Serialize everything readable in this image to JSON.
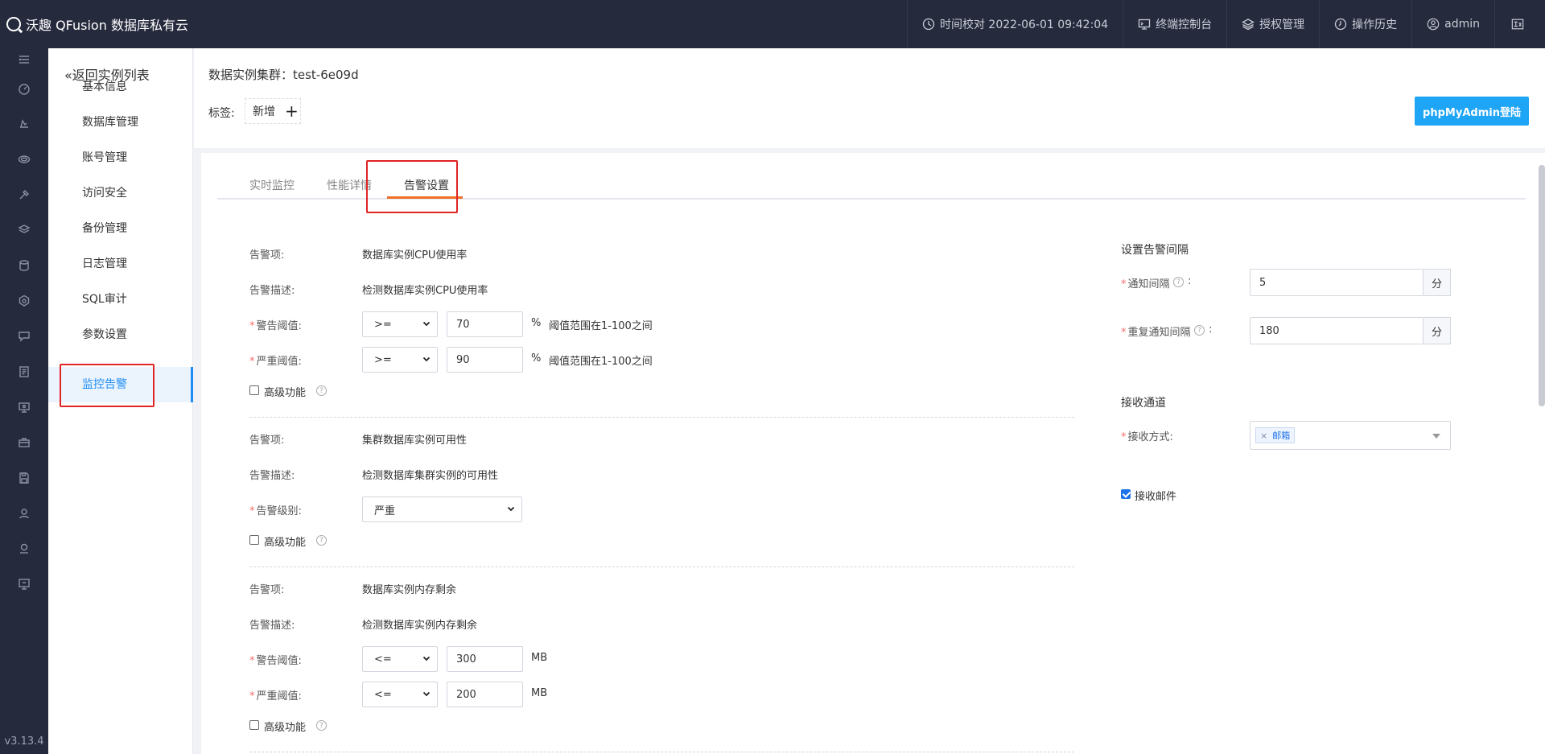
{
  "app": {
    "title": "沃趣 QFusion 数据库私有云",
    "version": "v3.13.4"
  },
  "topbar": {
    "time_sync": "时间校对 2022-06-01 09:42:04",
    "terminal": "终端控制台",
    "license": "授权管理",
    "history": "操作历史",
    "user": "admin"
  },
  "rail": {
    "icons": [
      "menu-icon",
      "dashboard-icon",
      "cloud-icon",
      "database-icon",
      "tools-icon",
      "layers-icon",
      "storage-icon",
      "security-icon",
      "feedback-icon",
      "document-icon",
      "monitor-icon",
      "briefcase-icon",
      "save-icon",
      "users-icon",
      "account-icon",
      "screen-icon"
    ]
  },
  "subnav": {
    "back": "返回实例列表",
    "items": [
      "基本信息",
      "数据库管理",
      "账号管理",
      "访问安全",
      "备份管理",
      "日志管理",
      "SQL审计",
      "参数设置",
      "监控告警"
    ],
    "active_index": 8
  },
  "header": {
    "cluster_label": "数据实例集群：test-6e09d",
    "tags_label": "标签:",
    "tag_new": "新增",
    "phpmyadmin_button": "phpMyAdmin登陆"
  },
  "tabs": [
    "实时监控",
    "性能详情",
    "告警设置"
  ],
  "active_tab": 2,
  "alerts": [
    {
      "item_label": "告警项:",
      "item_value": "数据库实例CPU使用率",
      "desc_label": "告警描述:",
      "desc_value": "检测数据库实例CPU使用率",
      "warn_label": "警告阈值:",
      "warn_op": ">=",
      "warn_value": "70",
      "warn_unit": "%",
      "warn_hint": "阈值范围在1-100之间",
      "crit_label": "严重阈值:",
      "crit_op": ">=",
      "crit_value": "90",
      "crit_unit": "%",
      "crit_hint": "阈值范围在1-100之间",
      "advanced": "高级功能"
    },
    {
      "item_label": "告警项:",
      "item_value": "集群数据库实例可用性",
      "desc_label": "告警描述:",
      "desc_value": "检测数据库集群实例的可用性",
      "level_label": "告警级别:",
      "level_value": "严重",
      "advanced": "高级功能"
    },
    {
      "item_label": "告警项:",
      "item_value": "数据库实例内存剩余",
      "desc_label": "告警描述:",
      "desc_value": "检测数据库实例内存剩余",
      "warn_label": "警告阈值:",
      "warn_op": "<=",
      "warn_value": "300",
      "warn_unit": "MB",
      "crit_label": "严重阈值:",
      "crit_op": "<=",
      "crit_value": "200",
      "crit_unit": "MB",
      "advanced": "高级功能"
    }
  ],
  "interval": {
    "title": "设置告警间隔",
    "notify_label": "通知间隔",
    "notify_value": "5",
    "notify_unit": "分",
    "repeat_label": "重复通知间隔",
    "repeat_value": "180",
    "repeat_unit": "分"
  },
  "channel": {
    "title": "接收通道",
    "method_label": "接收方式:",
    "method_chip": "邮箱",
    "receive_email": "接收邮件",
    "receive_email_checked": true
  },
  "colors": {
    "accent": "#1e8ef5",
    "topbar": "#262a3d",
    "tab_active": "#ef6f26",
    "highlight": "#e02424",
    "button": "#1ea5f6"
  }
}
